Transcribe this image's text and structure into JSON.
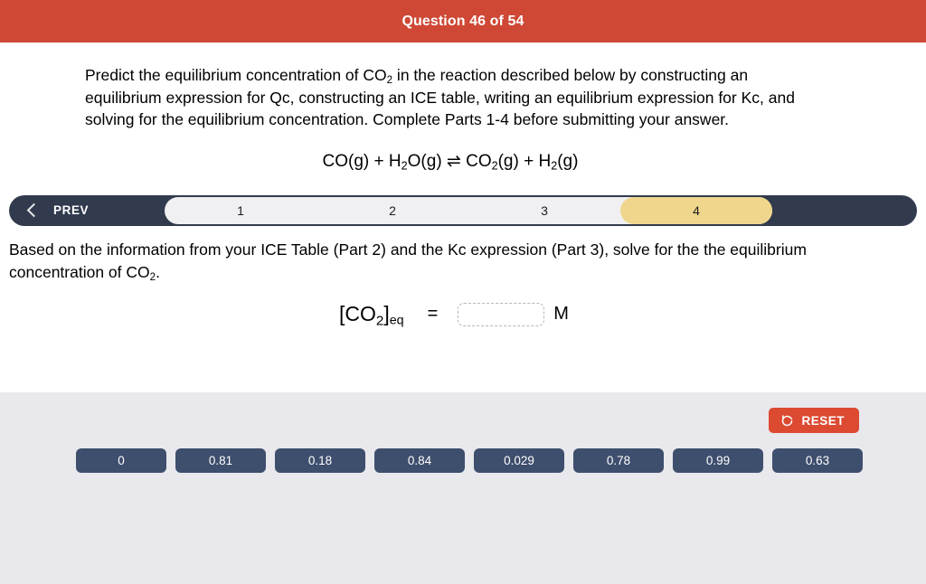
{
  "header": {
    "title": "Question 46 of 54",
    "background_color": "#ce4835"
  },
  "question": {
    "prompt_line1": "Predict the equilibrium concentration of CO",
    "prompt_sub1": "2",
    "prompt_line2": " in the reaction described below by constructing an equilibrium expression for Qc, constructing an ICE table, writing an equilibrium expression for Kc, and solving for the equilibrium concentration. Complete Parts 1-4 before submitting your answer.",
    "equation": {
      "reactant1": "CO(g)",
      "plus1": "+",
      "reactant2_a": "H",
      "reactant2_sub": "2",
      "reactant2_b": "O(g)",
      "arrow": "⇌",
      "product1_a": "CO",
      "product1_sub": "2",
      "product1_b": "(g)",
      "plus2": "+",
      "product2_a": "H",
      "product2_sub": "2",
      "product2_b": "(g)"
    }
  },
  "navigator": {
    "prev_label": "PREV",
    "prev_icon": "chevron-left-icon",
    "steps": [
      {
        "label": "1",
        "active": false
      },
      {
        "label": "2",
        "active": false
      },
      {
        "label": "3",
        "active": false
      },
      {
        "label": "4",
        "active": true
      }
    ],
    "bar_color": "#323a4d",
    "track_color": "#f0f0f2",
    "active_color": "#f0d68c"
  },
  "part": {
    "instruction_a": "Based on the information from your ICE Table (Part 2) and the  Kc expression (Part 3), solve for the the equilibrium concentration of CO",
    "instruction_sub": "2",
    "instruction_b": "."
  },
  "answer": {
    "bracket_open": "[CO",
    "formula_sub": "2",
    "bracket_close": "]",
    "subscript_eq": "eq",
    "equals": "=",
    "input_value": "",
    "input_placeholder": "",
    "unit": "M"
  },
  "tray": {
    "background_color": "#e8e8ed",
    "reset_label": "RESET",
    "reset_icon": "reset-arrow-icon",
    "reset_color": "#dc4a32",
    "chip_color": "#3e4e6d",
    "chips": [
      "0",
      "0.81",
      "0.18",
      "0.84",
      "0.029",
      "0.78",
      "0.99",
      "0.63"
    ]
  }
}
